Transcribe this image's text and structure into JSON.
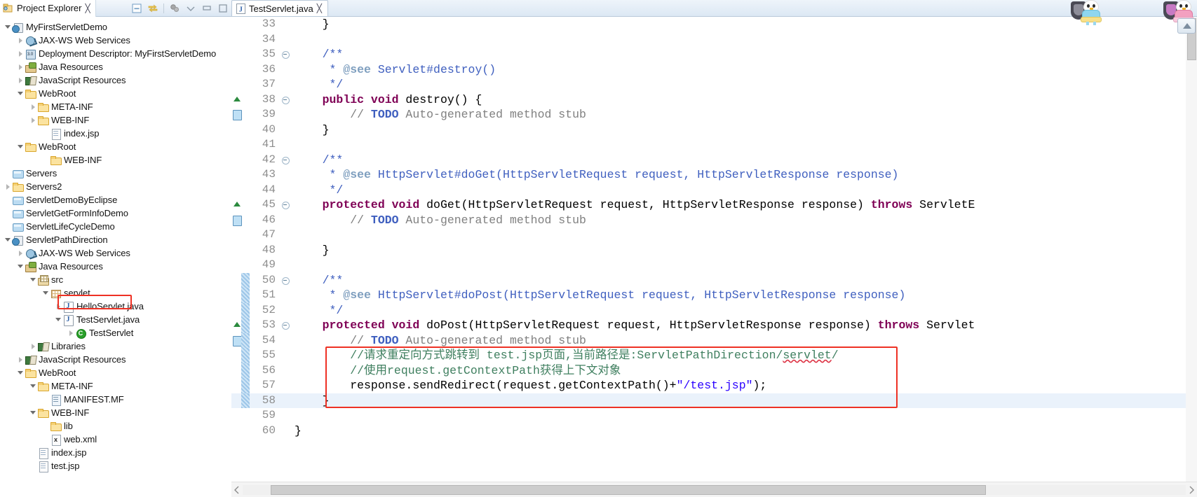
{
  "explorer": {
    "title": "Project Explorer",
    "close_icon": "close-icon",
    "toolbar": [
      {
        "name": "collapse-all-icon",
        "label": "Collapse All"
      },
      {
        "name": "link-with-editor-icon",
        "label": "Link with Editor"
      },
      {
        "name": "focus-on-active-task-icon",
        "label": "Focus on Active Task"
      },
      {
        "name": "view-menu-icon",
        "label": "View Menu"
      },
      {
        "name": "minimize-icon",
        "label": "Minimize"
      },
      {
        "name": "maximize-icon",
        "label": "Maximize"
      }
    ],
    "tree": [
      {
        "label": "MyFirstServletDemo",
        "indent": 0,
        "arrow": "open",
        "icon": "webproj"
      },
      {
        "label": "JAX-WS Web Services",
        "indent": 1,
        "arrow": "closed",
        "icon": "ws"
      },
      {
        "label": "Deployment Descriptor: MyFirstServletDemo",
        "indent": 1,
        "arrow": "closed",
        "icon": "dd"
      },
      {
        "label": "Java Resources",
        "indent": 1,
        "arrow": "closed",
        "icon": "javares"
      },
      {
        "label": "JavaScript Resources",
        "indent": 1,
        "arrow": "closed",
        "icon": "books"
      },
      {
        "label": "WebRoot",
        "indent": 1,
        "arrow": "open",
        "icon": "folder"
      },
      {
        "label": "META-INF",
        "indent": 2,
        "arrow": "closed",
        "icon": "folder"
      },
      {
        "label": "WEB-INF",
        "indent": 2,
        "arrow": "closed",
        "icon": "folder"
      },
      {
        "label": "index.jsp",
        "indent": 3,
        "arrow": "none",
        "icon": "file"
      },
      {
        "label": "WebRoot",
        "indent": 1,
        "arrow": "open",
        "icon": "folder"
      },
      {
        "label": "WEB-INF",
        "indent": 3,
        "arrow": "none",
        "icon": "folder"
      },
      {
        "label": "Servers",
        "indent": 0,
        "arrow": "none",
        "icon": "projfolder"
      },
      {
        "label": "Servers2",
        "indent": 0,
        "arrow": "closed",
        "icon": "folder"
      },
      {
        "label": "ServletDemoByEclipse",
        "indent": 0,
        "arrow": "none",
        "icon": "projfolder"
      },
      {
        "label": "ServletGetFormInfoDemo",
        "indent": 0,
        "arrow": "none",
        "icon": "projfolder"
      },
      {
        "label": "ServletLifeCycleDemo",
        "indent": 0,
        "arrow": "none",
        "icon": "projfolder"
      },
      {
        "label": "ServletPathDirection",
        "indent": 0,
        "arrow": "open",
        "icon": "webproj"
      },
      {
        "label": "JAX-WS Web Services",
        "indent": 1,
        "arrow": "closed",
        "icon": "ws"
      },
      {
        "label": "Java Resources",
        "indent": 1,
        "arrow": "open",
        "icon": "javares"
      },
      {
        "label": "src",
        "indent": 2,
        "arrow": "open",
        "icon": "srcpkg"
      },
      {
        "label": "servlet",
        "indent": 3,
        "arrow": "open",
        "icon": "pkg"
      },
      {
        "label": "HelloServlet.java",
        "indent": 4,
        "arrow": "closed",
        "icon": "java"
      },
      {
        "label": "TestServlet.java",
        "indent": 4,
        "arrow": "open",
        "icon": "java"
      },
      {
        "label": "TestServlet",
        "indent": 5,
        "arrow": "closed",
        "icon": "cls"
      },
      {
        "label": "Libraries",
        "indent": 2,
        "arrow": "closed",
        "icon": "books"
      },
      {
        "label": "JavaScript Resources",
        "indent": 1,
        "arrow": "closed",
        "icon": "books"
      },
      {
        "label": "WebRoot",
        "indent": 1,
        "arrow": "open",
        "icon": "folder"
      },
      {
        "label": "META-INF",
        "indent": 2,
        "arrow": "open",
        "icon": "folder"
      },
      {
        "label": "MANIFEST.MF",
        "indent": 3,
        "arrow": "none",
        "icon": "mf"
      },
      {
        "label": "WEB-INF",
        "indent": 2,
        "arrow": "open",
        "icon": "folder"
      },
      {
        "label": "lib",
        "indent": 3,
        "arrow": "none",
        "icon": "folder"
      },
      {
        "label": "web.xml",
        "indent": 3,
        "arrow": "none",
        "icon": "xml"
      },
      {
        "label": "index.jsp",
        "indent": 2,
        "arrow": "none",
        "icon": "file"
      },
      {
        "label": "test.jsp",
        "indent": 2,
        "arrow": "none",
        "icon": "file"
      }
    ],
    "highlight_row_index": 22
  },
  "editor": {
    "tab_label": "TestServlet.java",
    "tab_icon": "java-file-icon",
    "close_icon": "close-icon",
    "first_line": 33,
    "lines": [
      {
        "n": 33,
        "marker": "",
        "fold": false,
        "ruler": false,
        "cur": false,
        "tokens": [
          {
            "t": "    }",
            "c": "plain"
          }
        ]
      },
      {
        "n": 34,
        "marker": "",
        "fold": false,
        "ruler": false,
        "cur": false,
        "tokens": []
      },
      {
        "n": 35,
        "marker": "",
        "fold": true,
        "ruler": false,
        "cur": false,
        "tokens": [
          {
            "t": "    /**",
            "c": "doc"
          }
        ]
      },
      {
        "n": 36,
        "marker": "",
        "fold": false,
        "ruler": false,
        "cur": false,
        "tokens": [
          {
            "t": "     * ",
            "c": "doc"
          },
          {
            "t": "@see",
            "c": "doctag"
          },
          {
            "t": " Servlet#destroy()",
            "c": "doc"
          }
        ]
      },
      {
        "n": 37,
        "marker": "",
        "fold": false,
        "ruler": false,
        "cur": false,
        "tokens": [
          {
            "t": "     */",
            "c": "doc"
          }
        ]
      },
      {
        "n": 38,
        "marker": "override",
        "fold": true,
        "ruler": false,
        "cur": false,
        "tokens": [
          {
            "t": "    ",
            "c": "plain"
          },
          {
            "t": "public void",
            "c": "kw"
          },
          {
            "t": " destroy() {",
            "c": "plain"
          }
        ]
      },
      {
        "n": 39,
        "marker": "todo",
        "fold": false,
        "ruler": false,
        "cur": false,
        "tokens": [
          {
            "t": "        // ",
            "c": "cmt2"
          },
          {
            "t": "TODO",
            "c": "todo"
          },
          {
            "t": " Auto-generated method stub",
            "c": "cmt2"
          }
        ]
      },
      {
        "n": 40,
        "marker": "",
        "fold": false,
        "ruler": false,
        "cur": false,
        "tokens": [
          {
            "t": "    }",
            "c": "plain"
          }
        ]
      },
      {
        "n": 41,
        "marker": "",
        "fold": false,
        "ruler": false,
        "cur": false,
        "tokens": []
      },
      {
        "n": 42,
        "marker": "",
        "fold": true,
        "ruler": false,
        "cur": false,
        "tokens": [
          {
            "t": "    /**",
            "c": "doc"
          }
        ]
      },
      {
        "n": 43,
        "marker": "",
        "fold": false,
        "ruler": false,
        "cur": false,
        "tokens": [
          {
            "t": "     * ",
            "c": "doc"
          },
          {
            "t": "@see",
            "c": "doctag"
          },
          {
            "t": " HttpServlet#doGet(HttpServletRequest request, HttpServletResponse response)",
            "c": "doc"
          }
        ]
      },
      {
        "n": 44,
        "marker": "",
        "fold": false,
        "ruler": false,
        "cur": false,
        "tokens": [
          {
            "t": "     */",
            "c": "doc"
          }
        ]
      },
      {
        "n": 45,
        "marker": "override",
        "fold": true,
        "ruler": false,
        "cur": false,
        "tokens": [
          {
            "t": "    ",
            "c": "plain"
          },
          {
            "t": "protected void",
            "c": "kw"
          },
          {
            "t": " doGet(HttpServletRequest request, HttpServletResponse response) ",
            "c": "plain"
          },
          {
            "t": "throws",
            "c": "kw"
          },
          {
            "t": " ServletE",
            "c": "plain"
          }
        ]
      },
      {
        "n": 46,
        "marker": "todo",
        "fold": false,
        "ruler": false,
        "cur": false,
        "tokens": [
          {
            "t": "        // ",
            "c": "cmt2"
          },
          {
            "t": "TODO",
            "c": "todo"
          },
          {
            "t": " Auto-generated method stub",
            "c": "cmt2"
          }
        ]
      },
      {
        "n": 47,
        "marker": "",
        "fold": false,
        "ruler": false,
        "cur": false,
        "tokens": []
      },
      {
        "n": 48,
        "marker": "",
        "fold": false,
        "ruler": false,
        "cur": false,
        "tokens": [
          {
            "t": "    }",
            "c": "plain"
          }
        ]
      },
      {
        "n": 49,
        "marker": "",
        "fold": false,
        "ruler": false,
        "cur": false,
        "tokens": []
      },
      {
        "n": 50,
        "marker": "",
        "fold": true,
        "ruler": true,
        "cur": false,
        "tokens": [
          {
            "t": "    /**",
            "c": "doc"
          }
        ]
      },
      {
        "n": 51,
        "marker": "",
        "fold": false,
        "ruler": true,
        "cur": false,
        "tokens": [
          {
            "t": "     * ",
            "c": "doc"
          },
          {
            "t": "@see",
            "c": "doctag"
          },
          {
            "t": " HttpServlet#doPost(HttpServletRequest request, HttpServletResponse response)",
            "c": "doc"
          }
        ]
      },
      {
        "n": 52,
        "marker": "",
        "fold": false,
        "ruler": true,
        "cur": false,
        "tokens": [
          {
            "t": "     */",
            "c": "doc"
          }
        ]
      },
      {
        "n": 53,
        "marker": "override",
        "fold": true,
        "ruler": true,
        "cur": false,
        "tokens": [
          {
            "t": "    ",
            "c": "plain"
          },
          {
            "t": "protected void",
            "c": "kw"
          },
          {
            "t": " doPost(HttpServletRequest request, HttpServletResponse response) ",
            "c": "plain"
          },
          {
            "t": "throws",
            "c": "kw"
          },
          {
            "t": " Servlet",
            "c": "plain"
          }
        ]
      },
      {
        "n": 54,
        "marker": "todo",
        "fold": false,
        "ruler": true,
        "cur": false,
        "tokens": [
          {
            "t": "        // ",
            "c": "cmt2"
          },
          {
            "t": "TODO",
            "c": "todo"
          },
          {
            "t": " Auto-generated method stub",
            "c": "cmt2"
          }
        ]
      },
      {
        "n": 55,
        "marker": "",
        "fold": false,
        "ruler": true,
        "cur": false,
        "tokens": [
          {
            "t": "        //请求重定向方式跳转到 test.jsp页面,当前路径是:ServletPathDirection/",
            "c": "cmt"
          },
          {
            "t": "servlet",
            "c": "cmt sq"
          },
          {
            "t": "/",
            "c": "cmt"
          }
        ]
      },
      {
        "n": 56,
        "marker": "",
        "fold": false,
        "ruler": true,
        "cur": false,
        "tokens": [
          {
            "t": "        //使用request.getContextPath获得上下文对象",
            "c": "cmt"
          }
        ]
      },
      {
        "n": 57,
        "marker": "",
        "fold": false,
        "ruler": true,
        "cur": false,
        "tokens": [
          {
            "t": "        response.sendRedirect(request.getContextPath()+",
            "c": "plain"
          },
          {
            "t": "\"/test.jsp\"",
            "c": "str"
          },
          {
            "t": ");",
            "c": "plain"
          }
        ]
      },
      {
        "n": 58,
        "marker": "",
        "fold": false,
        "ruler": true,
        "cur": true,
        "tokens": [
          {
            "t": "    }",
            "c": "plain"
          }
        ]
      },
      {
        "n": 59,
        "marker": "",
        "fold": false,
        "ruler": false,
        "cur": false,
        "tokens": []
      },
      {
        "n": 60,
        "marker": "",
        "fold": false,
        "ruler": false,
        "cur": false,
        "tokens": [
          {
            "t": "}",
            "c": "plain"
          }
        ]
      }
    ]
  },
  "annotations": {
    "tree_highlight": {
      "name": "red-highlight-box-testservlet-java"
    },
    "code_highlight": {
      "name": "red-highlight-box-redirect-code"
    }
  },
  "colors": {
    "annotation_red": "#ee3124",
    "keyword": "#7f0055",
    "javadoc": "#3f5fbf",
    "comment": "#3f7f5f",
    "string": "#2a00ff",
    "line_number": "#8e8e8e",
    "current_line_bg": "#eaf2fb"
  },
  "scrollbars": {
    "horizontal": {
      "name": "editor-horizontal-scrollbar"
    },
    "vertical": {
      "name": "editor-vertical-scrollbar"
    }
  }
}
